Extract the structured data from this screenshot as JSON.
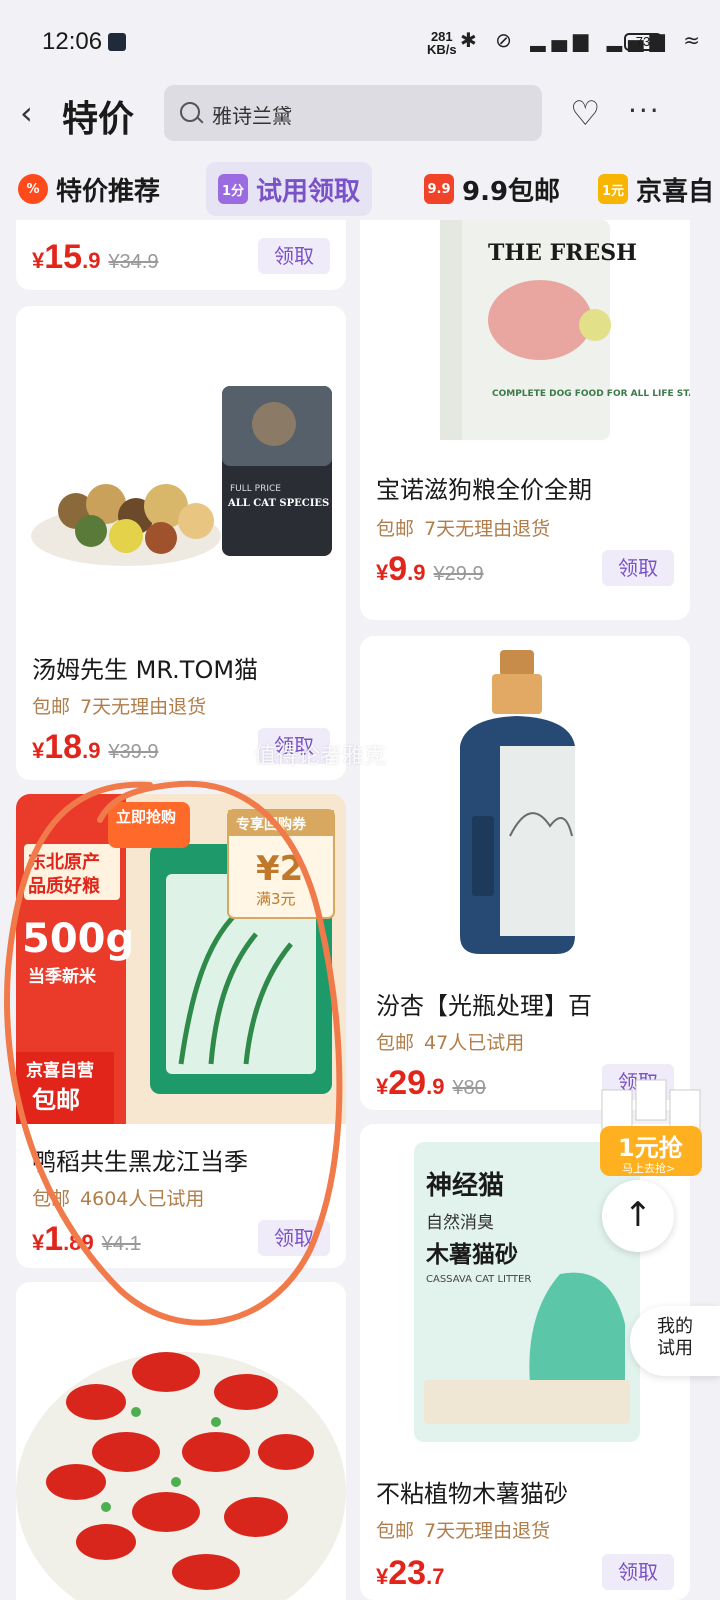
{
  "status": {
    "time": "12:06",
    "speed_top": "281",
    "speed_bottom": "KB/s",
    "icons": "✱ ⊘ ▂▄▆ ▂▄▆ ≈",
    "battery": "73"
  },
  "header": {
    "title": "特价",
    "search_placeholder": "雅诗兰黛"
  },
  "tabs": [
    {
      "label": "特价推荐",
      "icon": "%",
      "icon_color": "#ff4a1c"
    },
    {
      "label": "试用领取",
      "icon": "1分",
      "icon_color": "#9b6be0"
    },
    {
      "label": "9.9包邮",
      "icon": "9.9",
      "icon_color": "#f0432a"
    },
    {
      "label": "京喜自",
      "icon": "1元",
      "icon_color": "#f7b500"
    }
  ],
  "products": {
    "p1": {
      "name": "",
      "price_int": "15",
      "price_dec": ".9",
      "orig": "¥34.9",
      "claim": "领取"
    },
    "p2": {
      "name": "宝诺滋狗粮全价全期",
      "tag": "包邮",
      "meta": "7天无理由退货",
      "price_int": "9",
      "price_dec": ".9",
      "orig": "¥29.9",
      "claim": "领取",
      "img_text": "THE FRESH",
      "img_sub": "COMPLETE DOG FOOD FOR ALL LIFE STAGES"
    },
    "p3": {
      "name": "汤姆先生 MR.TOM猫",
      "tag": "包邮",
      "meta": "7天无理由退货",
      "price_int": "18",
      "price_dec": ".9",
      "orig": "¥39.9",
      "claim": "领取",
      "img_text": "FULL PRICE",
      "img_sub": "ALL CAT SPECIES"
    },
    "p4": {
      "name": "汾杏【光瓶处理】百",
      "tag": "包邮",
      "meta": "47人已试用",
      "price_int": "29",
      "price_dec": ".9",
      "orig": "¥80",
      "claim": "领取"
    },
    "p5": {
      "name": "鸭稻共生黑龙江当季",
      "tag": "包邮",
      "meta": "4604人已试用",
      "price_int": "1",
      "price_dec": ".89",
      "orig": "¥4.1",
      "claim": "领取",
      "img_badges": [
        "东北原产",
        "品质好粮",
        "500g",
        "当季新米",
        "京喜自营",
        "包邮",
        "立即抢购",
        "专享回购券",
        "¥2",
        "满3元"
      ]
    },
    "p6": {
      "name": "不粘植物木薯猫砂",
      "tag": "包邮",
      "meta": "7天无理由退货",
      "price_int": "23",
      "price_dec": ".7",
      "orig": "",
      "claim": "领取",
      "img_text1": "神经猫",
      "img_text2": "自然消臭",
      "img_text3": "木薯猫砂",
      "img_text4": "CASSAVA CAT LITTER"
    }
  },
  "floating": {
    "promo_line1": "1元抢",
    "promo_line2": "马上去抢>",
    "back_top": "↑",
    "my_trial_1": "我的",
    "my_trial_2": "试用",
    "watermark": "值得论者雅克"
  },
  "colors": {
    "price": "#e1251b",
    "accent": "#7a52c7",
    "meta": "#b07e4a",
    "annotation": "#f07a4a"
  }
}
